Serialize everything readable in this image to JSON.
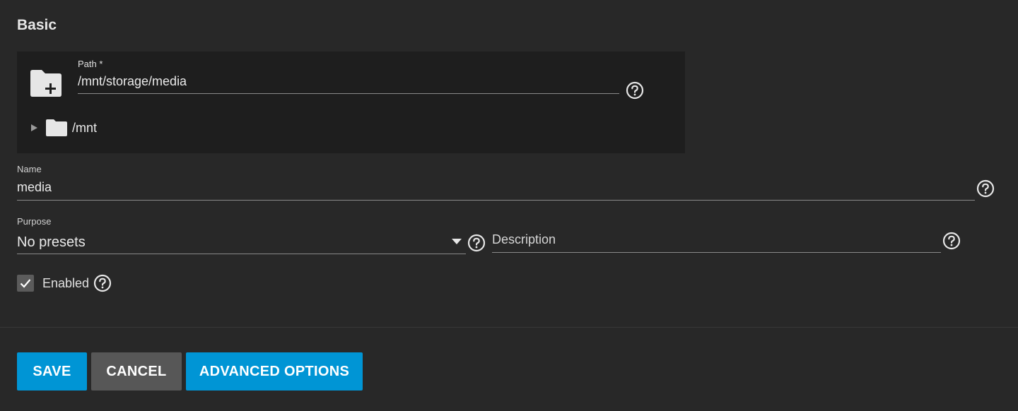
{
  "section": {
    "title": "Basic"
  },
  "path_field": {
    "label": "Path *",
    "value": "/mnt/storage/media"
  },
  "explorer": {
    "tree": [
      {
        "label": "/mnt"
      }
    ]
  },
  "name_field": {
    "label": "Name",
    "value": "media"
  },
  "purpose_field": {
    "label": "Purpose",
    "selected": "No presets"
  },
  "description_field": {
    "placeholder": "Description"
  },
  "enabled": {
    "label": "Enabled",
    "checked": true
  },
  "buttons": {
    "save": "SAVE",
    "cancel": "CANCEL",
    "advanced": "ADVANCED OPTIONS"
  },
  "colors": {
    "background": "#282828",
    "panel": "#1e1e1e",
    "primary": "#0095d5",
    "secondary": "#575757"
  },
  "icons": [
    "folder-plus-icon",
    "help-icon",
    "caret-right-icon",
    "folder-icon",
    "dropdown-arrow-icon",
    "check-icon"
  ]
}
